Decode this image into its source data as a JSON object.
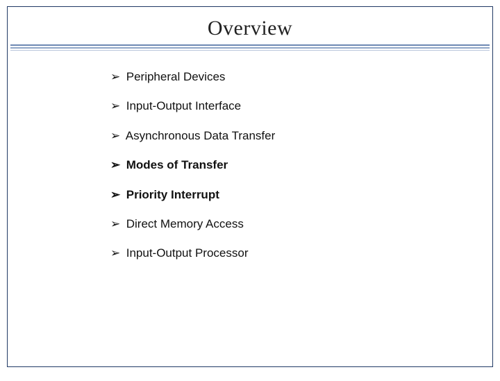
{
  "slide": {
    "title": "Overview",
    "bullet_char": "➢",
    "items": [
      {
        "text": "Peripheral Devices",
        "bold": false
      },
      {
        "text": "Input-Output Interface",
        "bold": false
      },
      {
        "text": "Asynchronous Data Transfer",
        "bold": false
      },
      {
        "text": "Modes of Transfer",
        "bold": true
      },
      {
        "text": "Priority Interrupt",
        "bold": true
      },
      {
        "text": "Direct Memory Access",
        "bold": false
      },
      {
        "text": "Input-Output Processor",
        "bold": false
      }
    ]
  }
}
